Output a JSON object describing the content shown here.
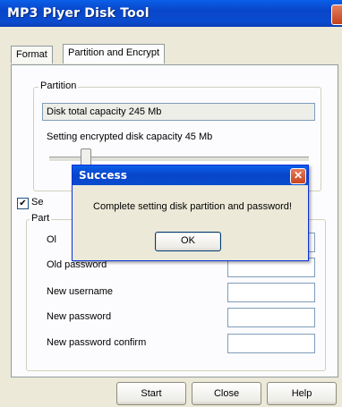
{
  "window": {
    "title": "MP3 Plyer Disk Tool"
  },
  "tabs": [
    {
      "label": "Format"
    },
    {
      "label": "Partition and Encrypt"
    }
  ],
  "partition_group": {
    "legend": "Partition",
    "total_capacity": "Disk total capacity 245 Mb",
    "encrypted_capacity": "Setting encrypted disk capacity 45 Mb"
  },
  "password_section": {
    "checkbox_label_visible": "Se",
    "checkbox_checked_glyph": "✔",
    "group_legend_visible": "Part",
    "rows": [
      {
        "label": "Ol"
      },
      {
        "label": "Old password"
      },
      {
        "label": "New username"
      },
      {
        "label": "New password"
      },
      {
        "label": "New password confirm"
      }
    ]
  },
  "buttons": {
    "start": "Start",
    "close": "Close",
    "help": "Help"
  },
  "dialog": {
    "title": "Success",
    "close_glyph": "✕",
    "message": "Complete setting disk partition and password!",
    "ok": "OK"
  }
}
